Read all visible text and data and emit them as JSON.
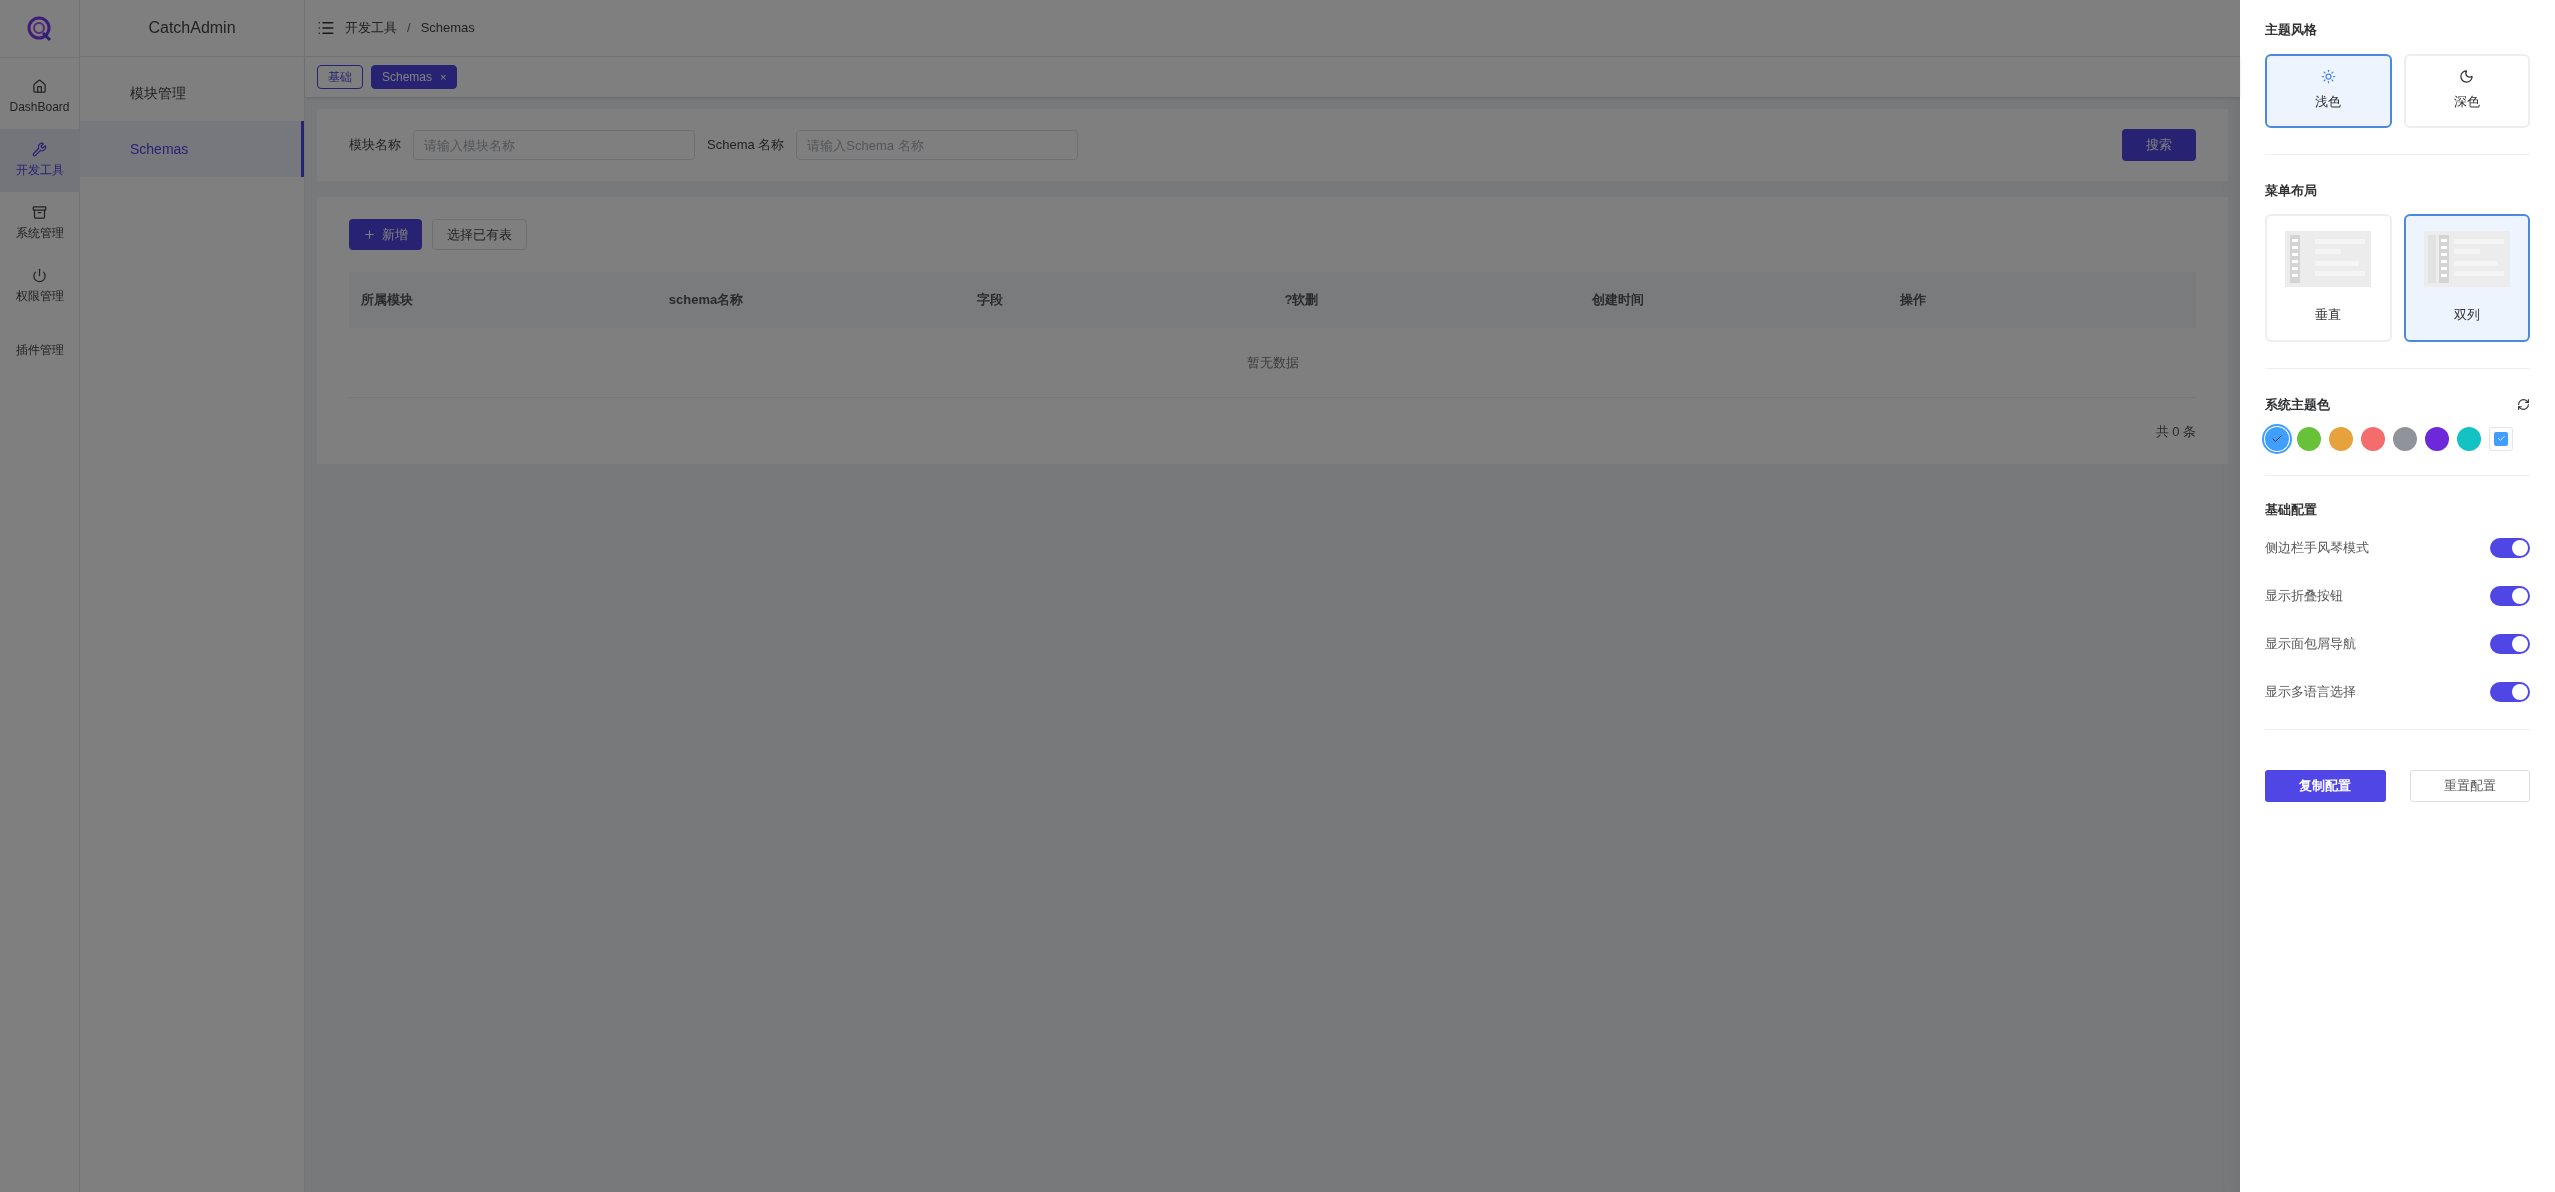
{
  "app_name": "CatchAdmin",
  "rail": [
    {
      "label": "DashBoard",
      "selected": false
    },
    {
      "label": "开发工具",
      "selected": true
    },
    {
      "label": "系统管理",
      "selected": false
    },
    {
      "label": "权限管理",
      "selected": false
    },
    {
      "label": "插件管理",
      "selected": false
    }
  ],
  "submenu": [
    {
      "label": "模块管理",
      "selected": false
    },
    {
      "label": "Schemas",
      "selected": true
    }
  ],
  "breadcrumb": {
    "items": [
      "开发工具",
      "Schemas"
    ],
    "separator": "/"
  },
  "tabs": [
    {
      "label": "基础",
      "selected": false
    },
    {
      "label": "Schemas",
      "selected": true,
      "close": "×"
    }
  ],
  "search_form": {
    "fields": [
      {
        "label": "模块名称",
        "placeholder": "请输入模块名称"
      },
      {
        "label": "Schema 名称",
        "placeholder": "请输入Schema 名称"
      }
    ],
    "button": "搜索"
  },
  "toolbar": [
    {
      "label": "新增",
      "kind": "primary"
    },
    {
      "label": "选择已有表",
      "kind": "default"
    }
  ],
  "table": {
    "columns": [
      "所属模块",
      "schema名称",
      "字段",
      "?软删",
      "创建时间",
      "操作"
    ],
    "empty_text": "暂无数据",
    "total": "共 0 条"
  },
  "settings": {
    "theme_style": {
      "title": "主题风格",
      "options": [
        {
          "label": "浅色",
          "selected": true
        },
        {
          "label": "深色",
          "selected": false
        }
      ]
    },
    "menu_layout": {
      "title": "菜单布局",
      "options": [
        {
          "label": "垂直",
          "selected": false
        },
        {
          "label": "双列",
          "selected": true
        }
      ]
    },
    "theme_color": {
      "title": "系统主题色",
      "swatches": [
        {
          "kind": "swatch",
          "color": "#409eff",
          "selected": true
        },
        {
          "kind": "swatch",
          "color": "#67c23a",
          "selected": false
        },
        {
          "kind": "swatch",
          "color": "#e6a23c",
          "selected": false
        },
        {
          "kind": "swatch",
          "color": "#f56c6c",
          "selected": false
        },
        {
          "kind": "swatch",
          "color": "#909399",
          "selected": false
        },
        {
          "kind": "swatch",
          "color": "#6d28d9",
          "selected": false
        },
        {
          "kind": "swatch",
          "color": "#13c2c2",
          "selected": false
        },
        {
          "kind": "picker",
          "color": "#409eff",
          "selected": false
        }
      ]
    },
    "basic": {
      "title": "基础配置",
      "toggles": [
        {
          "label": "侧边栏手风琴模式",
          "on": true
        },
        {
          "label": "显示折叠按钮",
          "on": true
        },
        {
          "label": "显示面包屑导航",
          "on": true
        },
        {
          "label": "显示多语言选择",
          "on": true
        }
      ]
    },
    "buttons": [
      {
        "label": "复制配置",
        "kind": "primary"
      },
      {
        "label": "重置配置",
        "kind": "default"
      }
    ]
  }
}
